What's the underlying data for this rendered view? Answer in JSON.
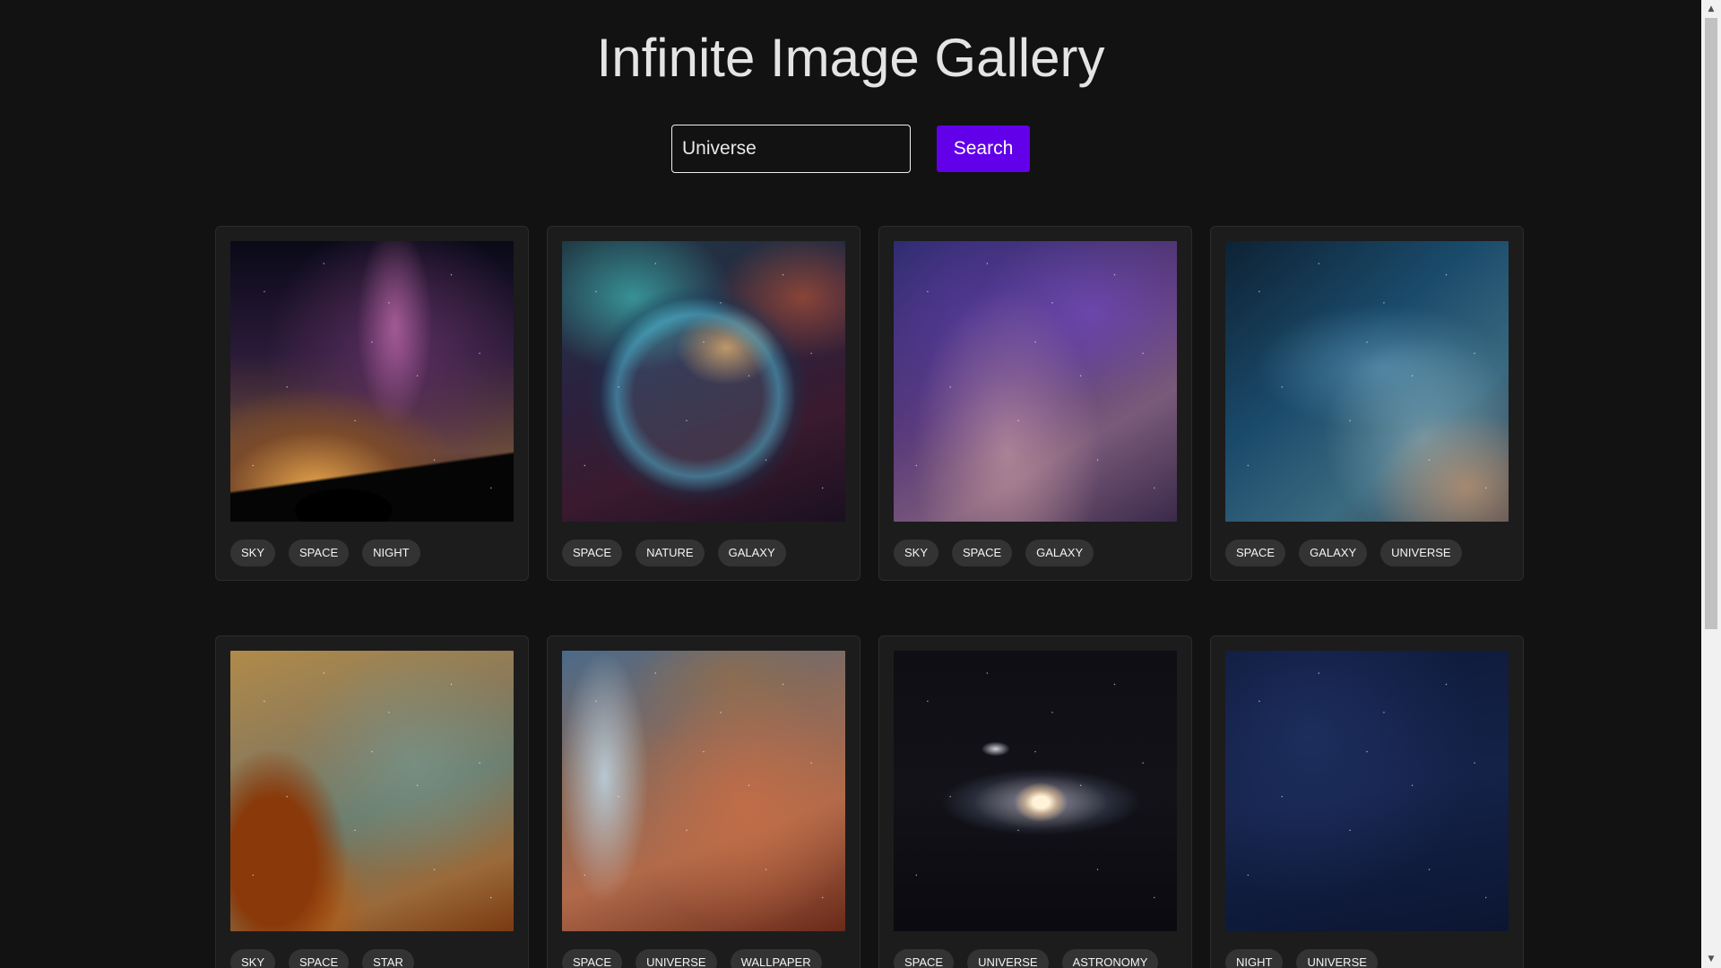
{
  "page": {
    "title": "Infinite Image Gallery"
  },
  "search": {
    "value": "Universe",
    "button_label": "Search"
  },
  "gallery": {
    "cards": [
      {
        "image_icon": "milky-way-silhouette-image",
        "tags": [
          "SKY",
          "SPACE",
          "NIGHT"
        ]
      },
      {
        "image_icon": "bubble-nebula-image",
        "tags": [
          "SPACE",
          "NATURE",
          "GALAXY"
        ]
      },
      {
        "image_icon": "purple-starfield-image",
        "tags": [
          "SKY",
          "SPACE",
          "GALAXY"
        ]
      },
      {
        "image_icon": "blue-milky-way-image",
        "tags": [
          "SPACE",
          "GALAXY",
          "UNIVERSE"
        ]
      },
      {
        "image_icon": "orange-nebula-image",
        "tags": [
          "SKY",
          "SPACE",
          "STAR"
        ]
      },
      {
        "image_icon": "carina-nebula-image",
        "tags": [
          "SPACE",
          "UNIVERSE",
          "WALLPAPER"
        ]
      },
      {
        "image_icon": "andromeda-galaxy-image",
        "tags": [
          "SPACE",
          "UNIVERSE",
          "ASTRONOMY"
        ]
      },
      {
        "image_icon": "night-sky-image",
        "tags": [
          "NIGHT",
          "UNIVERSE"
        ]
      }
    ]
  },
  "colors": {
    "background": "#121212",
    "card": "#1c1c1c",
    "accent": "#6200ea",
    "tag": "#333333"
  }
}
